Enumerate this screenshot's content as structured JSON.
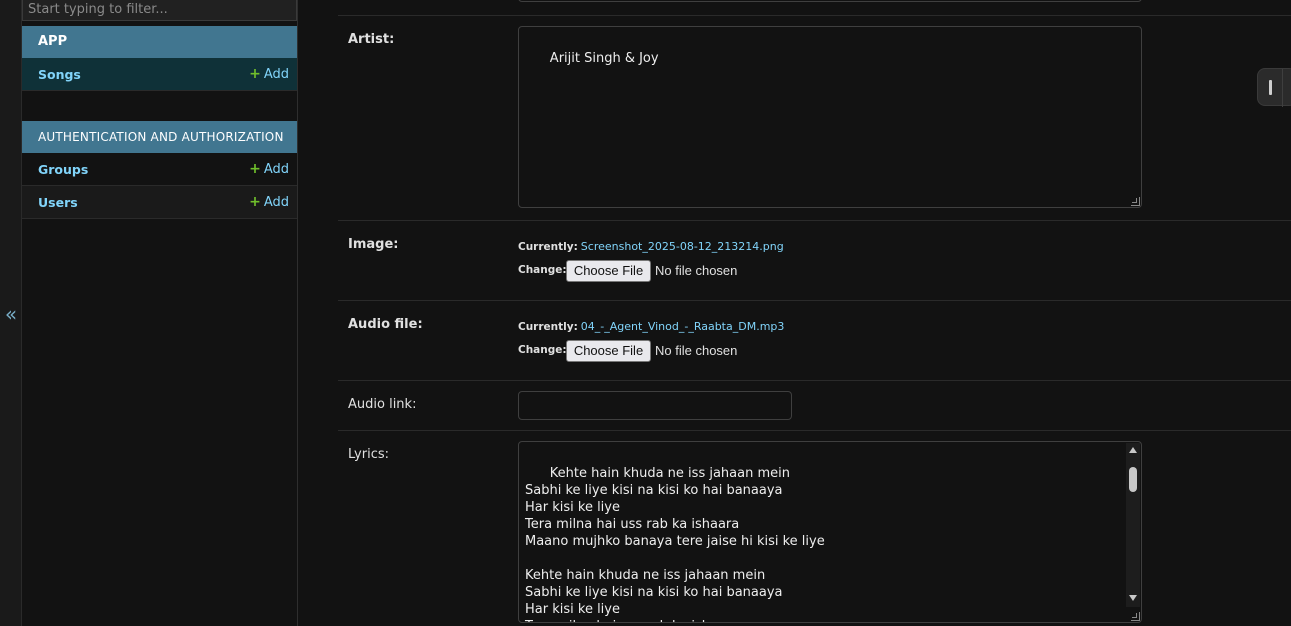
{
  "sidebar": {
    "filter_placeholder": "Start typing to filter...",
    "collapse_glyph": "«",
    "modules": [
      {
        "caption": "APP",
        "models": [
          {
            "name": "Songs",
            "add_label": "Add"
          }
        ]
      },
      {
        "caption": "AUTHENTICATION AND AUTHORIZATION",
        "models": [
          {
            "name": "Groups",
            "add_label": "Add"
          },
          {
            "name": "Users",
            "add_label": "Add"
          }
        ]
      }
    ],
    "plus_glyph": "+"
  },
  "form": {
    "artist": {
      "label": "Artist:",
      "value": "Arijit Singh & Joy"
    },
    "image": {
      "label": "Image:",
      "currently_label": "Currently:",
      "currently_value": "Screenshot_2025-08-12_213214.png",
      "change_label": "Change:",
      "button_label": "Choose File",
      "no_file_text": "No file chosen"
    },
    "audio_file": {
      "label": "Audio file:",
      "currently_label": "Currently:",
      "currently_value": "04_-_Agent_Vinod_-_Raabta_DM.mp3",
      "change_label": "Change:",
      "button_label": "Choose File",
      "no_file_text": "No file chosen"
    },
    "audio_link": {
      "label": "Audio link:",
      "value": ""
    },
    "lyrics": {
      "label": "Lyrics:",
      "value": "Kehte hain khuda ne iss jahaan mein\nSabhi ke liye kisi na kisi ko hai banaaya\nHar kisi ke liye\nTera milna hai uss rab ka ishaara\nMaano mujhko banaya tere jaise hi kisi ke liye\n\nKehte hain khuda ne iss jahaan mein\nSabhi ke liye kisi na kisi ko hai banaaya\nHar kisi ke liye\nTera milna hai uss rab ka ishaara\nMaano mujhko banaya tere jaise hi kisi ke liye"
    }
  },
  "colors": {
    "module_header": "#417690",
    "selected_row": "#0f3138",
    "link": "#81d4fa",
    "add_plus": "#70bf2b",
    "background": "#121212"
  },
  "icons": {
    "collapse": "double-chevron-left-icon",
    "add": "plus-icon"
  }
}
